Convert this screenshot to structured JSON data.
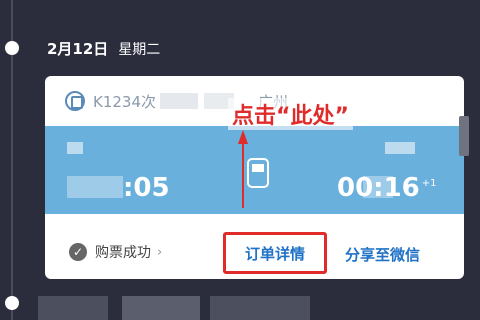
{
  "date": "2月12日",
  "weekday": "星期二",
  "train_no": "K1234次",
  "dest_fragment": "广州",
  "depart_time_partial": ":05",
  "arrive_time_partial": "00:16",
  "arrive_day_offset": "+1",
  "status_text": "购票成功",
  "status_chevron": "›",
  "order_detail": "订单详情",
  "share_wechat": "分享至微信",
  "annotation": "点击“此处”",
  "colors": {
    "accent_blue": "#1f72c6",
    "band_blue": "#6ab0dc",
    "annotation_red": "#e02b2b",
    "background": "#2b2d3d"
  }
}
